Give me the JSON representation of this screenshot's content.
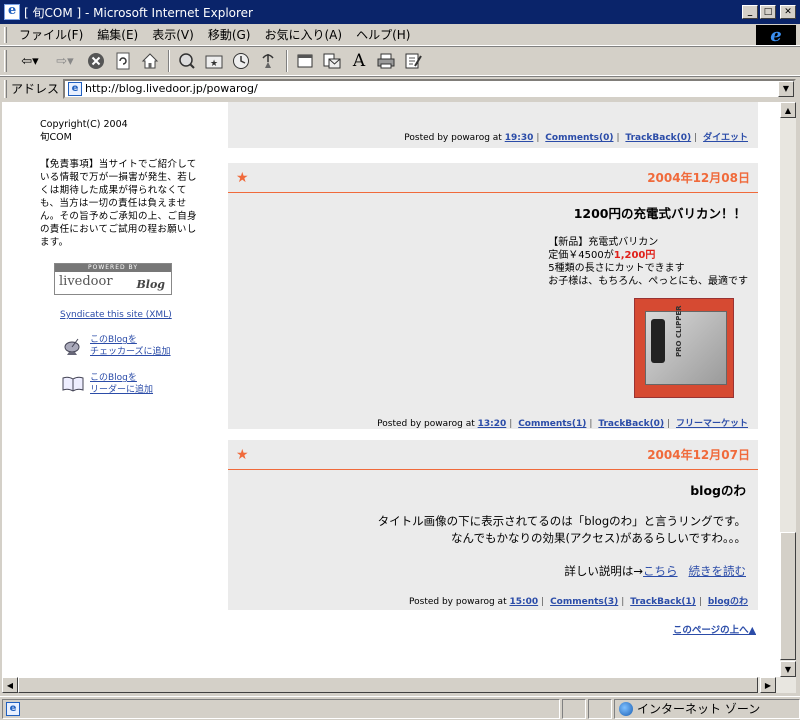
{
  "window": {
    "title": "[ 旬COM ] - Microsoft Internet Explorer"
  },
  "menu": [
    "ファイル(F)",
    "編集(E)",
    "表示(V)",
    "移動(G)",
    "お気に入り(A)",
    "ヘルプ(H)"
  ],
  "toolbar": {
    "icons": [
      "back-icon",
      "forward-icon",
      "stop-icon",
      "refresh-icon",
      "home-icon",
      "search-icon",
      "favorites-icon",
      "history-icon",
      "channels-icon",
      "fullscreen-icon",
      "mail-icon",
      "font-icon",
      "print-icon",
      "edit-icon"
    ]
  },
  "address": {
    "label": "アドレス",
    "url": "http://blog.livedoor.jp/powarog/"
  },
  "status": {
    "zone": "インターネット ゾーン"
  },
  "sidebar": {
    "copyright_line1": "Copyright(C) 2004",
    "copyright_line2": "旬COM",
    "disclaimer": "【免責事項】当サイトでご紹介している情報で万が一損害が発生、若しくは期待した成果が得られなくても、当方は一切の責任は負えません。その旨予めご承知の上、ご自身の責任においてご試用の程お願いします。",
    "powered_top": "POWERED BY",
    "powered_name": "livedoor",
    "powered_blog": "Blog",
    "syndicate": "Syndicate this site (XML)",
    "checkers_line1": "このBlogを",
    "checkers_line2": "チェッカーズに追加",
    "reader_line1": "このBlogを",
    "reader_line2": "リーダーに追加"
  },
  "posts": [
    {
      "posted_by": "Posted by powarog at",
      "time": "19:30",
      "comments": "Comments(0)",
      "trackback": "TrackBack(0)",
      "category": "ダイエット"
    },
    {
      "date": "2004年12月08日",
      "title": "1200円の充電式バリカン！！",
      "line1": "【新品】充電式バリカン",
      "line2_prefix": "定価￥4500が",
      "line2_price": "1,200円",
      "line3": "5種類の長さにカットできます",
      "line4": "お子様は、もちろん、ぺっとにも、最適です",
      "photo_text": "PRO CLIPPER",
      "posted_by": "Posted by powarog at",
      "time": "13:20",
      "comments": "Comments(1)",
      "trackback": "TrackBack(0)",
      "category": "フリーマーケット"
    },
    {
      "date": "2004年12月07日",
      "title": "blogのわ",
      "line1": "タイトル画像の下に表示されてるのは「blogのわ」と言うリングです。",
      "line2": "なんでもかなりの効果(アクセス)があるらしいですわ。。。",
      "detail_prefix": "詳しい説明は→",
      "detail_link": "こちら",
      "continue_link": "続きを読む",
      "posted_by": "Posted by powarog at",
      "time": "15:00",
      "comments": "Comments(3)",
      "trackback": "TrackBack(1)",
      "category": "blogのわ"
    }
  ],
  "page_top": "このページの上へ▲"
}
